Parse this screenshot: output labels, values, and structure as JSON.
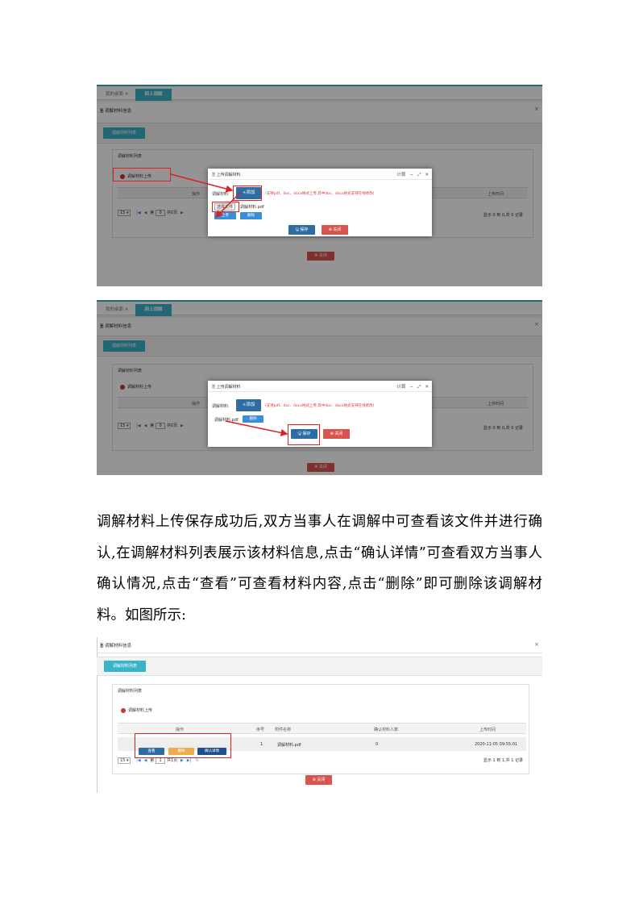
{
  "common": {
    "tab_home": "我的桌面",
    "tab_close": "✕",
    "tab_active": "网上调解",
    "panel_title": "调解材料信息",
    "list_button": "调解材料列表",
    "group_title": "调解材料列表",
    "upload_link": "调解材料上传",
    "col_operation": "操作",
    "col_upload_time": "上传时间",
    "page_size": "15",
    "page_word_prefix": "第",
    "page_word_total": "共",
    "page_word_suffix": "页",
    "close_label": "关闭",
    "save_label": "保存"
  },
  "shot1": {
    "page_num": "0",
    "page_total": "0",
    "info": "显示 0 到 0,共 0 记录",
    "dialog": {
      "title": "上传调解材料",
      "icons": [
        "计算",
        "−",
        "⤢",
        "✕"
      ],
      "field_label": "调解材料:",
      "add_label": "+添加",
      "note": "(支持pdf、doc、docx格式上传,其中doc、docx格式支持在线修改)",
      "choose_file": "选择文件",
      "file_name": "调解材料.pdf",
      "upload_btn": "上传",
      "delete_btn": "删除"
    }
  },
  "shot2": {
    "page_num": "0",
    "page_total": "0",
    "info": "显示 0 到 0,共 0 记录",
    "dialog": {
      "title": "上传调解材料",
      "icons": [
        "计算",
        "−",
        "⤢",
        "✕"
      ],
      "field_label": "调解材料:",
      "add_label": "+添加",
      "note": "(支持pdf、doc、docx格式上传,其中doc、docx格式支持在线修改)",
      "file_name": "调解材料.pdf",
      "delete_btn": "删除"
    }
  },
  "paragraph": "调解材料上传保存成功后,双方当事人在调解中可查看该文件并进行确认,在调解材料列表展示该材料信息,点击“确认详情”可查看双方当事人确认情况,点击“查看”可查看材料内容,点击“删除”即可删除该调解材料。如图所示:",
  "shot3": {
    "col_seq": "序号",
    "col_attach": "附件名称",
    "col_confirm": "确认材料人数",
    "row": {
      "seq": "1",
      "name": "调解材料.pdf",
      "confirm": "0",
      "time": "2020-11-05 09:55:01"
    },
    "actions": {
      "view": "查看",
      "delete": "删除",
      "confirm": "确认详情"
    },
    "page_num": "1",
    "page_total": "1",
    "info": "显示 1 到 1,共 1 记录"
  },
  "colors": {
    "accent": "#3ab4c9",
    "primary": "#2e6da4",
    "danger": "#d9534f",
    "warning": "#f0ad4e",
    "annotation": "#e02020"
  }
}
